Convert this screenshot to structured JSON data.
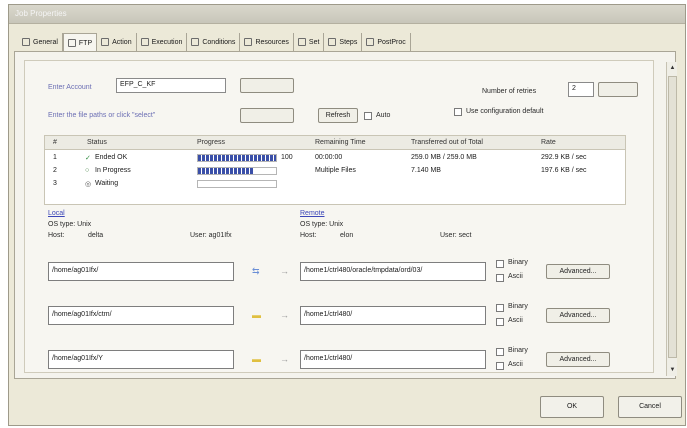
{
  "window": {
    "title": "Job Properties"
  },
  "tabs": [
    {
      "label": "General",
      "icon": "document-icon"
    },
    {
      "label": "FTP",
      "icon": "ftp-icon"
    },
    {
      "label": "Action",
      "icon": "action-icon"
    },
    {
      "label": "Execution",
      "icon": "execution-icon"
    },
    {
      "label": "Conditions",
      "icon": "conditions-icon"
    },
    {
      "label": "Resources",
      "icon": "resources-icon"
    },
    {
      "label": "Set",
      "icon": "set-icon"
    },
    {
      "label": "Steps",
      "icon": "steps-icon"
    },
    {
      "label": "PostProc",
      "icon": "postproc-icon"
    }
  ],
  "ftp": {
    "account_label": "Enter Account",
    "account_value": "EFP_C_KF",
    "filepath_label": "Enter the file paths or click \"select\"",
    "refresh_label": "Refresh",
    "auto_label": "Auto",
    "retries_label": "Number of retries",
    "retries_value": "2",
    "use_default_label": "Use configuration default",
    "table": {
      "headers": [
        "#",
        "Status",
        "Progress",
        "Remaining Time",
        "Transferred out of Total",
        "Rate"
      ],
      "rows": [
        {
          "num": "1",
          "status": "Ended OK",
          "progress": 1.0,
          "progress_text": "100",
          "remaining": "00:00:00",
          "transferred": "259.0 MB / 259.0 MB",
          "rate": "292.9 KB / sec"
        },
        {
          "num": "2",
          "status": "In Progress",
          "progress": 0.72,
          "progress_text": "",
          "remaining": "Multiple Files",
          "transferred": "7.140 MB",
          "rate": "197.6 KB / sec"
        },
        {
          "num": "3",
          "status": "Waiting",
          "progress": 0.0,
          "progress_text": "",
          "remaining": "",
          "transferred": "",
          "rate": ""
        }
      ]
    },
    "local": {
      "title": "Local",
      "os_type": "OS type: Unix",
      "host": "Host:",
      "host_value": "delta",
      "user": "User: ag01Ifx"
    },
    "remote": {
      "title": "Remote",
      "os_type": "OS type: Unix",
      "host": "Host:",
      "host_value": "elon",
      "user": "User: sect"
    },
    "transfers": [
      {
        "local": "/home/ag01Ifx/",
        "remote": "/home1/ctrl480/oracle/tmpdata/ord/03/",
        "binary": "Binary",
        "ascii": "Ascii",
        "advanced": "Advanced..."
      },
      {
        "local": "/home/ag01Ifx/ctm/",
        "remote": "/home1/ctrl480/",
        "binary": "Binary",
        "ascii": "Ascii",
        "advanced": "Advanced..."
      },
      {
        "local": "/home/ag01Ifx/Y",
        "remote": "/home1/ctrl480/",
        "binary": "Binary",
        "ascii": "Ascii",
        "advanced": "Advanced..."
      }
    ]
  },
  "buttons": {
    "ok": "OK",
    "cancel": "Cancel"
  }
}
